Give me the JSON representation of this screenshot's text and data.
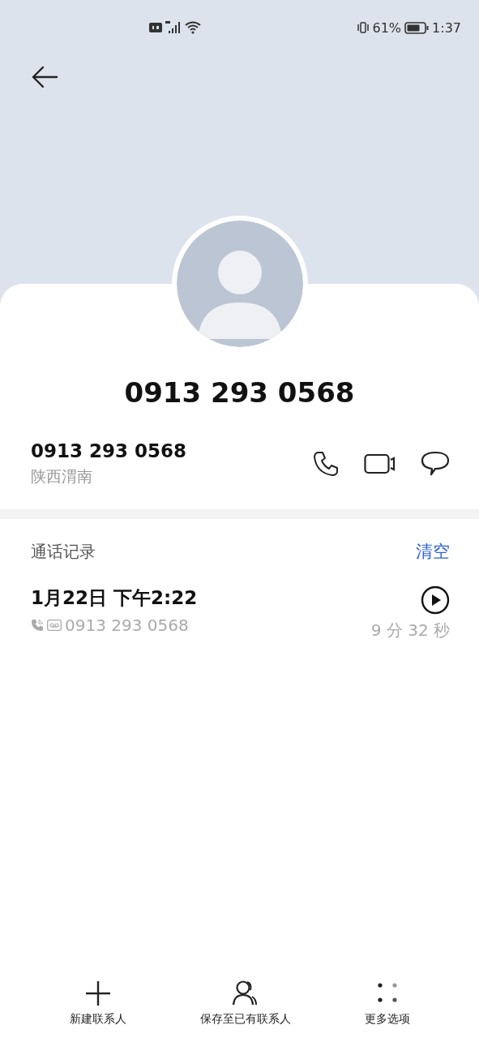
{
  "status_bar": {
    "battery": "61%",
    "time": "1:37"
  },
  "contact": {
    "title": "0913 293 0568",
    "number": "0913 293 0568",
    "location": "陕西渭南"
  },
  "call_log": {
    "title": "通话记录",
    "clear_label": "清空",
    "entries": [
      {
        "date": "1月22日 下午2:22",
        "number": "0913 293 0568",
        "duration": "9 分 32 秒",
        "recorded": true
      }
    ]
  },
  "bottom_actions": [
    {
      "kind": "add",
      "label": "新建联系人"
    },
    {
      "kind": "contact",
      "label": "保存至已有联系人"
    },
    {
      "kind": "more",
      "label": "更多选项"
    }
  ]
}
